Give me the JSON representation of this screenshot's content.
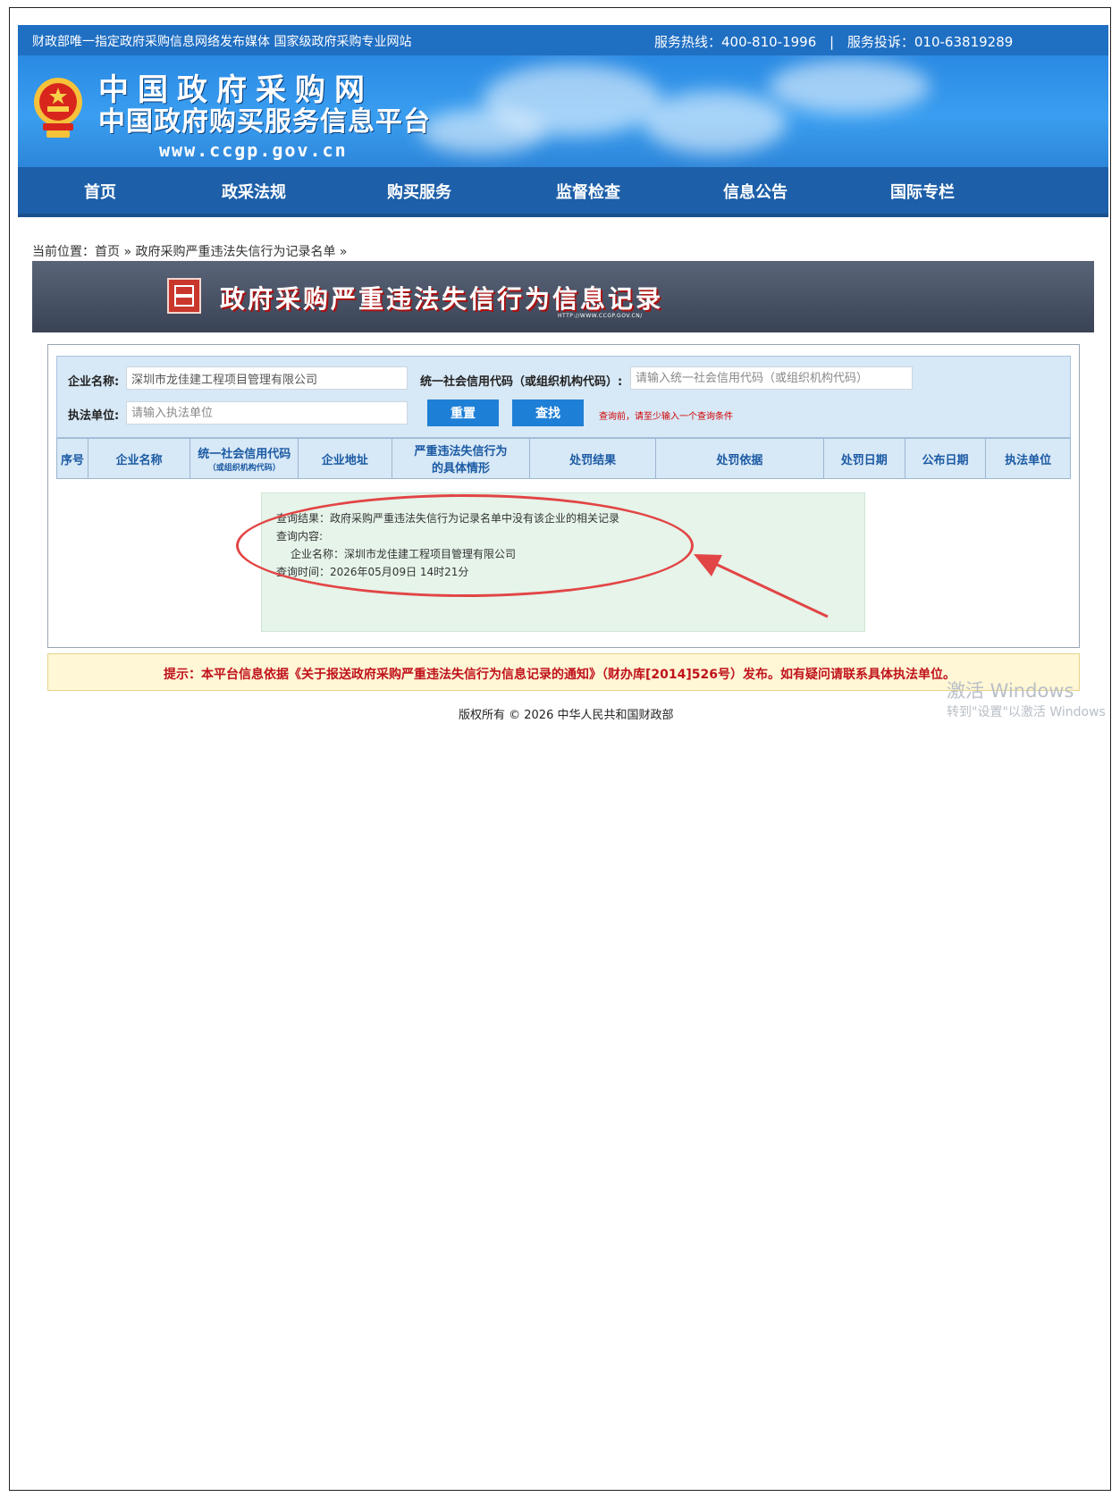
{
  "topbar": {
    "left_text": "财政部唯一指定政府采购信息网络发布媒体 国家级政府采购专业网站",
    "hotline": "服务热线：400-810-1996",
    "separator": "|",
    "complaint": "服务投诉：010-63819289"
  },
  "header": {
    "logo_title": "中国政府采购网",
    "logo_subtitle": "中国政府购买服务信息平台",
    "logo_url": "www.ccgp.gov.cn"
  },
  "nav": {
    "items": [
      {
        "label": "首页"
      },
      {
        "label": "政采法规"
      },
      {
        "label": "购买服务"
      },
      {
        "label": "监督检查"
      },
      {
        "label": "信息公告"
      },
      {
        "label": "国际专栏"
      }
    ]
  },
  "breadcrumb": {
    "prefix": "当前位置：",
    "home": "首页",
    "sep1": " » ",
    "current": "政府采购严重违法失信行为记录名单",
    "sep2": " »"
  },
  "page_title": {
    "text": "政府采购严重违法失信行为信息记录",
    "url": "HTTP://WWW.CCGP.GOV.CN/"
  },
  "form": {
    "company_label": "企业名称:",
    "company_value": "深圳市龙佳建工程项目管理有限公司",
    "credit_label": "统一社会信用代码（或组织机构代码）:",
    "credit_placeholder": "请输入统一社会信用代码（或组织机构代码）",
    "unit_label": "执法单位:",
    "unit_placeholder": "请输入执法单位",
    "reset_label": "重置",
    "search_label": "查找",
    "hint": "查询前，请至少输入一个查询条件"
  },
  "table": {
    "headers": [
      {
        "main": "序号",
        "sub": ""
      },
      {
        "main": "企业名称",
        "sub": ""
      },
      {
        "main": "统一社会信用代码",
        "sub": "（或组织机构代码）"
      },
      {
        "main": "企业地址",
        "sub": ""
      },
      {
        "main": "严重违法失信行为的具体情形",
        "sub": ""
      },
      {
        "main": "处罚结果",
        "sub": ""
      },
      {
        "main": "处罚依据",
        "sub": ""
      },
      {
        "main": "处罚日期",
        "sub": ""
      },
      {
        "main": "公布日期",
        "sub": ""
      },
      {
        "main": "执法单位",
        "sub": ""
      }
    ]
  },
  "result": {
    "line1": "查询结果：政府采购严重违法失信行为记录名单中没有该企业的相关记录",
    "line2": "查询内容:",
    "line3": "企业名称：深圳市龙佳建工程项目管理有限公司",
    "line4": "查询时间：2026年05月09日 14时21分"
  },
  "notice": {
    "text": "提示：本平台信息依据《关于报送政府采购严重违法失信行为信息记录的通知》（财办库[2014]526号）发布。如有疑问请联系具体执法单位。"
  },
  "footer": {
    "copyright": "版权所有 © 2026 中华人民共和国财政部"
  },
  "watermark": {
    "line1": "激活 Windows",
    "line2": "转到\"设置\"以激活 Windows"
  },
  "colors": {
    "topbar": "#1f6fc3",
    "nav": "#1d5fa8",
    "button": "#1e7fd6",
    "annotation": "#e24545",
    "notice_text": "#c0121b"
  }
}
